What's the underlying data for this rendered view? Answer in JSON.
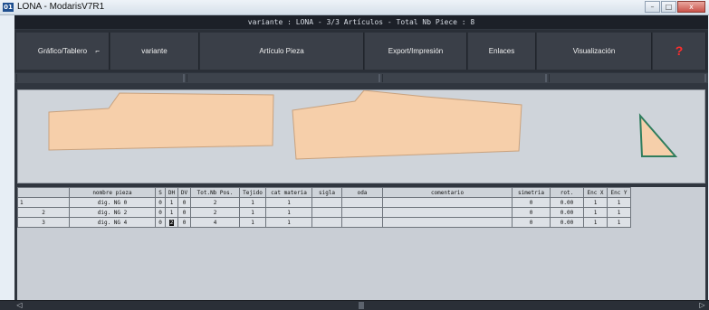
{
  "window": {
    "app_icon": "01",
    "title": "LONA - ModarisV7R1",
    "minimize": "–",
    "maximize": "□",
    "close": "x"
  },
  "info_bar": "variante : LONA - 3/3 Artículos - Total Nb Piece : 8",
  "menu": [
    {
      "label": "Gráfico/Tablero",
      "mark": "⌐"
    },
    {
      "label": "variante"
    },
    {
      "label": "Artículo Pieza"
    },
    {
      "label": "Export/Impresión"
    },
    {
      "label": "Enlaces"
    },
    {
      "label": "Visualización"
    },
    {
      "label": "?"
    }
  ],
  "colors": {
    "piece_fill": "#f6cfaa",
    "piece_stroke": "#c9a27e",
    "triangle_stroke": "#2f7d5d",
    "help_accent": "#ff2d2d"
  },
  "table": {
    "headers": [
      "",
      "nombre pieza",
      "S",
      "DH",
      "DV",
      "Tot.Nb Pos.",
      "Tejido",
      "cat materia",
      "sigla",
      "oda",
      "comentario",
      "simetria",
      "rot.",
      "Enc X",
      "Enc Y"
    ],
    "rows": [
      [
        "1",
        "dig. NG 0",
        "0",
        "1",
        "0",
        "2",
        "1",
        "1",
        "",
        "",
        "",
        "0",
        "0.00",
        "1",
        "1"
      ],
      [
        "2",
        "dig. NG 2",
        "0",
        "1",
        "0",
        "2",
        "1",
        "1",
        "",
        "",
        "",
        "0",
        "0.00",
        "1",
        "1"
      ],
      [
        "3",
        "dig. NG 4",
        "0",
        "2",
        "0",
        "4",
        "1",
        "1",
        "",
        "",
        "",
        "0",
        "0.00",
        "1",
        "1"
      ]
    ]
  },
  "scrollbar": {
    "left_arrow": "◁",
    "right_arrow": "▷"
  }
}
